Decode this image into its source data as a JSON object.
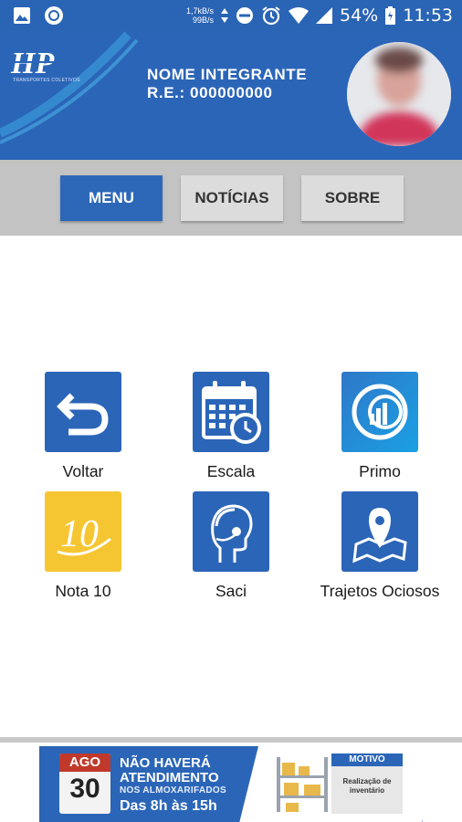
{
  "status_bar": {
    "net_speed_up": "1,7kB/s",
    "net_speed_down": "99B/s",
    "battery": "54%",
    "time": "11:53"
  },
  "header": {
    "brand_sub": "TRANSPORTES COLETIVOS",
    "member_name": "NOME INTEGRANTE",
    "member_re": "R.E.: 000000000"
  },
  "nav": {
    "menu": "MENU",
    "news": "NOTÍCIAS",
    "about": "SOBRE"
  },
  "tiles": [
    {
      "label": "Voltar",
      "icon": "undo-arrow-icon"
    },
    {
      "label": "Escala",
      "icon": "calendar-clock-icon"
    },
    {
      "label": "Primo",
      "icon": "primo-chart-icon"
    },
    {
      "label": "Nota 10",
      "icon": "nota10-icon"
    },
    {
      "label": "Saci",
      "icon": "headset-agent-icon"
    },
    {
      "label": "Trajetos Ociosos",
      "icon": "map-pin-icon"
    }
  ],
  "banner": {
    "month": "AGO",
    "day": "30",
    "line1": "NÃO HAVERÁ",
    "line2": "ATENDIMENTO",
    "line3": "NOS ALMOXARIFADOS",
    "line4": "Das 8h às 15h",
    "motivo_title": "MOTIVO",
    "motivo_text": "Realização de inventário"
  },
  "colors": {
    "primary": "#2b65b8",
    "nav_inactive": "#dcdcdc",
    "nav_bar": "#c3c3c3",
    "nota10_yellow": "#f6c632"
  }
}
